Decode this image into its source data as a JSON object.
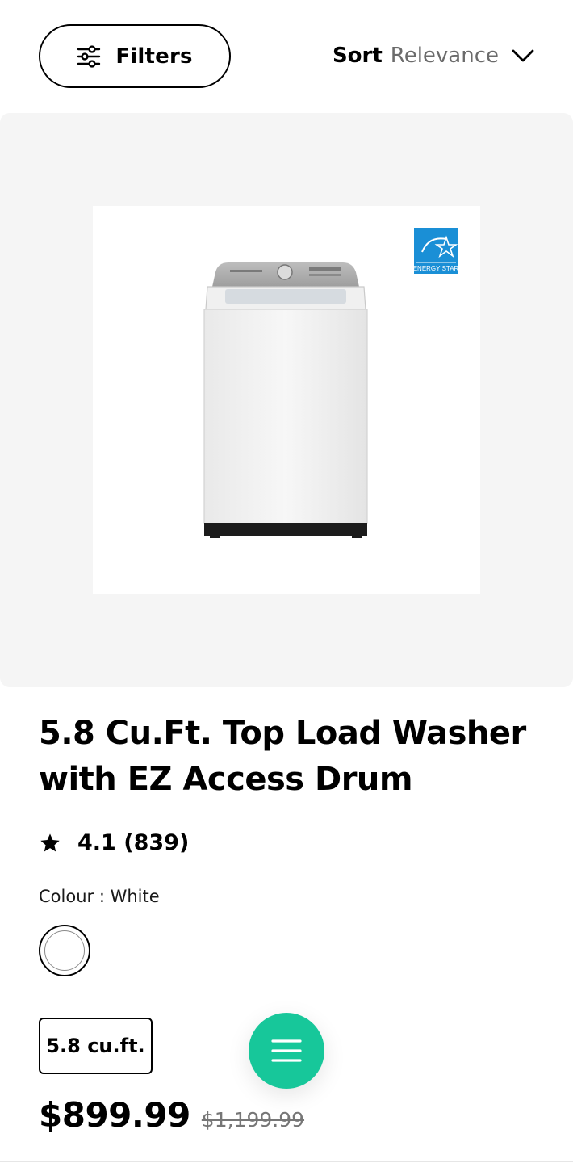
{
  "toolbar": {
    "filters_label": "Filters",
    "filters_icon": "sliders-icon",
    "sort_label": "Sort",
    "sort_value": "Relevance",
    "sort_icon": "chevron-down-icon"
  },
  "product": {
    "image_alt": "Samsung top load washer",
    "badge": "ENERGY STAR",
    "title": "5.8 Cu.Ft. Top Load Washer with EZ Access Drum",
    "rating": "4.1",
    "review_count": "(839)",
    "rating_icon": "star-icon",
    "colour_label": "Colour : White",
    "colour_swatch": "#ffffff",
    "size_option": "5.8 cu.ft.",
    "price": "$899.99",
    "original_price": "$1,199.99"
  },
  "fab": {
    "icon": "menu-icon",
    "color": "#17c79a"
  }
}
